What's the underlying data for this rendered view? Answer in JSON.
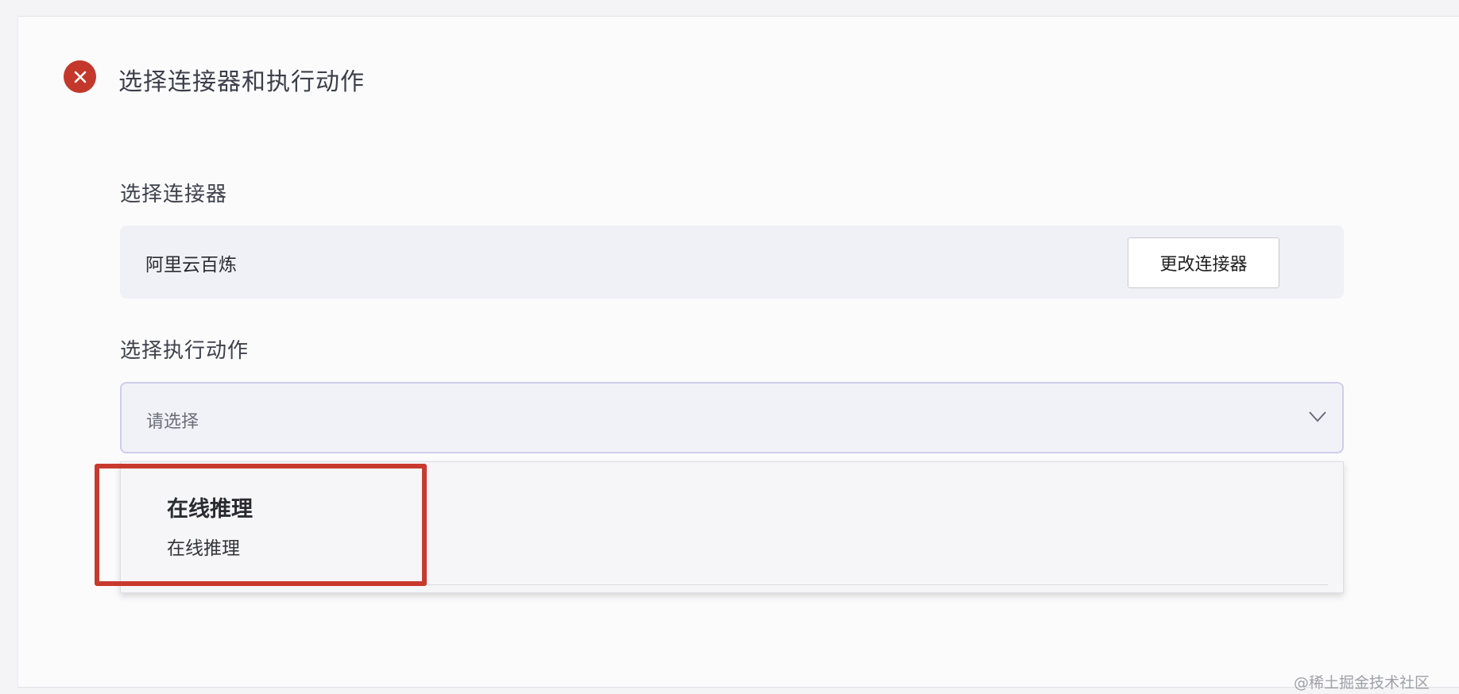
{
  "step": {
    "title": "选择连接器和执行动作",
    "status_icon": "close-circle-icon",
    "status_color": "#c4382c"
  },
  "connector": {
    "label": "选择连接器",
    "value": "阿里云百炼",
    "change_button": "更改连接器"
  },
  "action": {
    "label": "选择执行动作",
    "placeholder": "请选择",
    "options": [
      {
        "title": "在线推理",
        "description": "在线推理"
      }
    ]
  },
  "annotation": {
    "highlight_color": "#c83a2d"
  },
  "watermark": "@稀土掘金技术社区"
}
